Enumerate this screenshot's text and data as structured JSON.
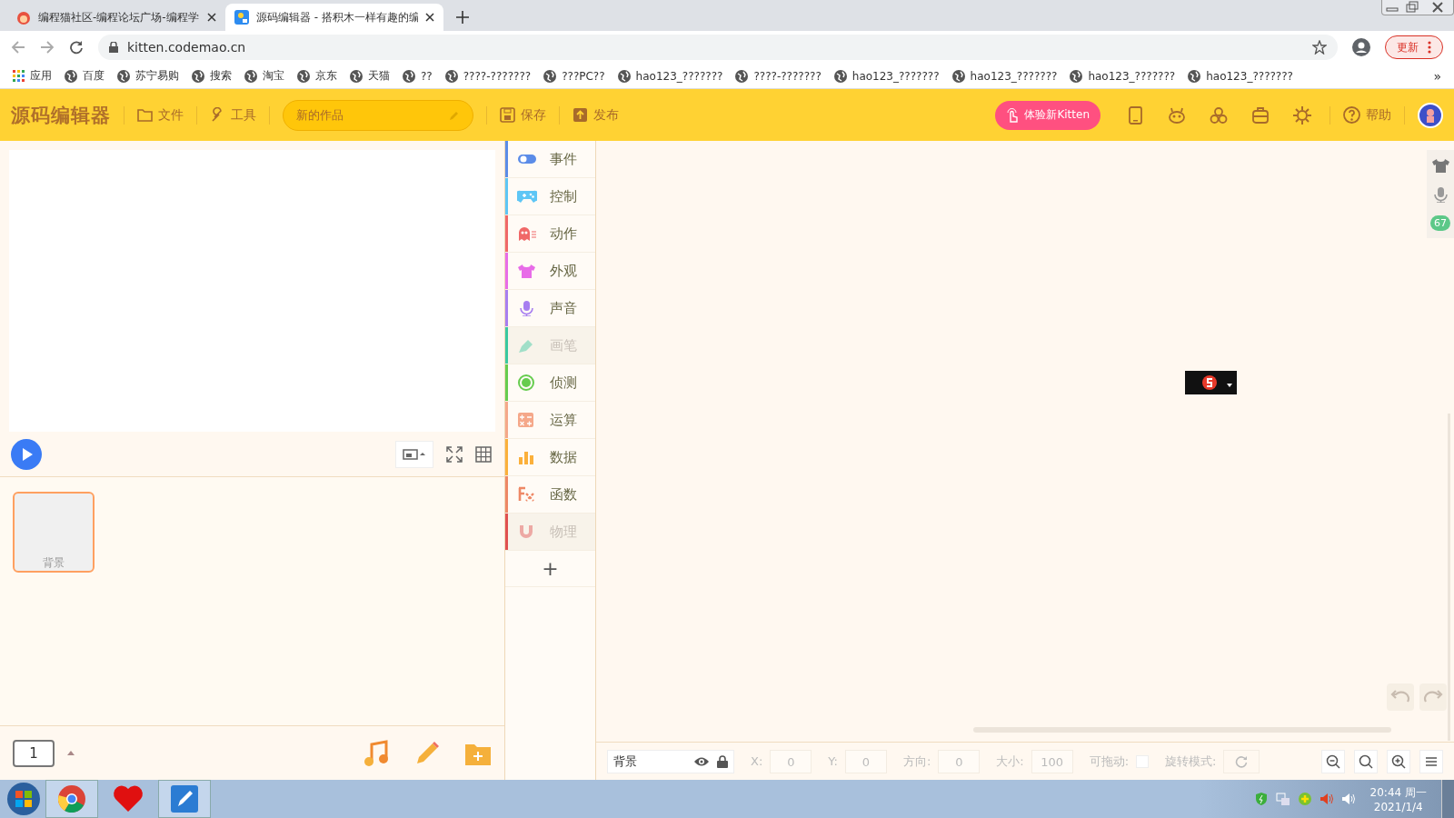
{
  "browser": {
    "tabs": [
      {
        "title": "编程猫社区-编程论坛广场-编程学",
        "selected": false
      },
      {
        "title": "源码编辑器 - 搭积木一样有趣的编",
        "selected": true
      }
    ],
    "url": "kitten.codemao.cn",
    "update_button": "更新",
    "bookmarks": [
      "应用",
      "百度",
      "苏宁易购",
      "搜索",
      "淘宝",
      "京东",
      "天猫",
      "??",
      "????-???????",
      "???PC??",
      "hao123_???????",
      "????-???????",
      "hao123_???????",
      "hao123_???????",
      "hao123_???????",
      "hao123_???????"
    ],
    "more": "»"
  },
  "toolbar": {
    "logo": "源码编辑器",
    "menus": [
      "文件",
      "工具"
    ],
    "project_name": "新的作品",
    "actions": [
      "保存",
      "发布"
    ],
    "try_button": "体验新Kitten",
    "help": "帮助"
  },
  "sprites": [
    {
      "label": "背景",
      "selected": true
    }
  ],
  "scene_number": "1",
  "categories": [
    {
      "label": "事件",
      "color": "#5b8ce8",
      "disabled": false
    },
    {
      "label": "控制",
      "color": "#5ec6f5",
      "disabled": false
    },
    {
      "label": "动作",
      "color": "#f06868",
      "disabled": false
    },
    {
      "label": "外观",
      "color": "#e86ce8",
      "disabled": false
    },
    {
      "label": "声音",
      "color": "#a77ef0",
      "disabled": false
    },
    {
      "label": "画笔",
      "color": "#3ac9a0",
      "disabled": true
    },
    {
      "label": "侦测",
      "color": "#66cc4e",
      "disabled": false
    },
    {
      "label": "运算",
      "color": "#f5a88a",
      "disabled": false
    },
    {
      "label": "数据",
      "color": "#fbb03b",
      "disabled": false
    },
    {
      "label": "函数",
      "color": "#ee8866",
      "disabled": false
    },
    {
      "label": "物理",
      "color": "#e05050",
      "disabled": true
    }
  ],
  "add_category": "+",
  "side_badge": "67",
  "properties": {
    "name": "背景",
    "fields": [
      {
        "label": "X:",
        "value": "0"
      },
      {
        "label": "Y:",
        "value": "0"
      },
      {
        "label": "方向:",
        "value": "0"
      },
      {
        "label": "大小:",
        "value": "100"
      }
    ],
    "draggable_label": "可拖动:",
    "draggable": false,
    "rotation_label": "旋转模式:"
  },
  "taskbar": {
    "time": "20:44 周一",
    "date": "2021/1/4"
  }
}
